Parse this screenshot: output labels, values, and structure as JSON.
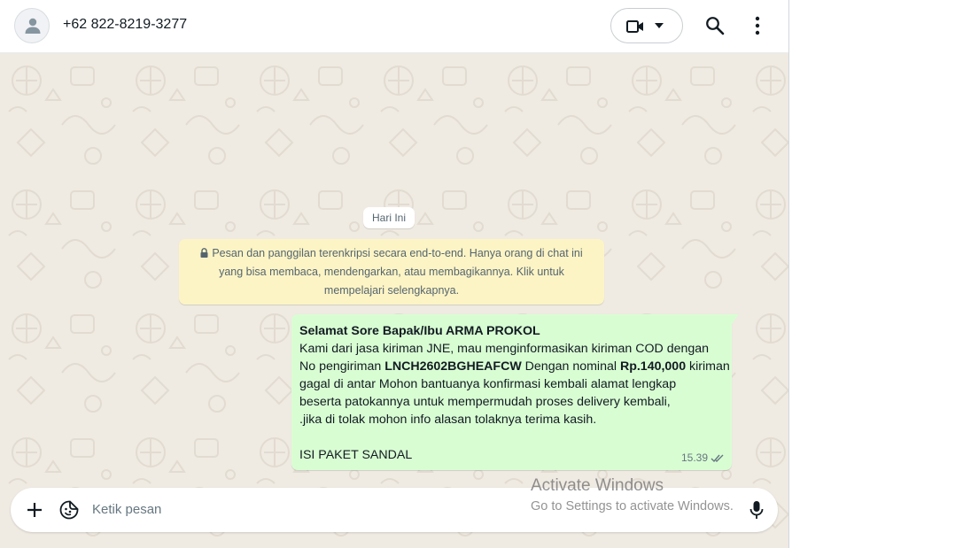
{
  "header": {
    "contact_name": "+62 822-8219-3277",
    "icons": [
      "person-icon",
      "video-call-icon",
      "chevron-down-icon",
      "search-icon",
      "more-vertical-icon"
    ]
  },
  "chat": {
    "date_chip": "Hari Ini",
    "encryption_notice": {
      "line1": "Pesan dan panggilan terenkripsi secara end-to-end. Hanya orang di chat ini",
      "line2": "yang bisa membaca, mendengarkan, atau membagikannya. Klik untuk",
      "line3": "mempelajari selengkapnya."
    },
    "message": {
      "greeting": "Selamat Sore Bapak/Ibu ARMA PROKOL",
      "line2": "Kami dari jasa kiriman JNE, mau menginformasikan kiriman COD dengan",
      "line3_a": "No pengiriman ",
      "tracking_no": "LNCH2602BGHEAFCW",
      "line3_b": " Dengan nominal ",
      "amount": "Rp.140,000",
      "line3_c": " kiriman",
      "line4": "gagal di antar Mohon bantuanya konfirmasi kembali alamat lengkap",
      "line5": "beserta patokannya untuk mempermudah proses delivery kembali,",
      "line6": " .jika di tolak mohon info alasan tolaknya terima kasih.",
      "line7": "ISI PAKET SANDAL",
      "time": "15.39",
      "status": "read"
    }
  },
  "composer": {
    "placeholder": "Ketik pesan"
  },
  "watermark": {
    "title": "Activate Windows",
    "subtitle": "Go to Settings to activate Windows."
  },
  "colors": {
    "chat_background": "#efeae2",
    "outgoing_bubble": "#d9fdd3",
    "notice_background": "#fdf4c5",
    "read_ticks": "#667781"
  }
}
